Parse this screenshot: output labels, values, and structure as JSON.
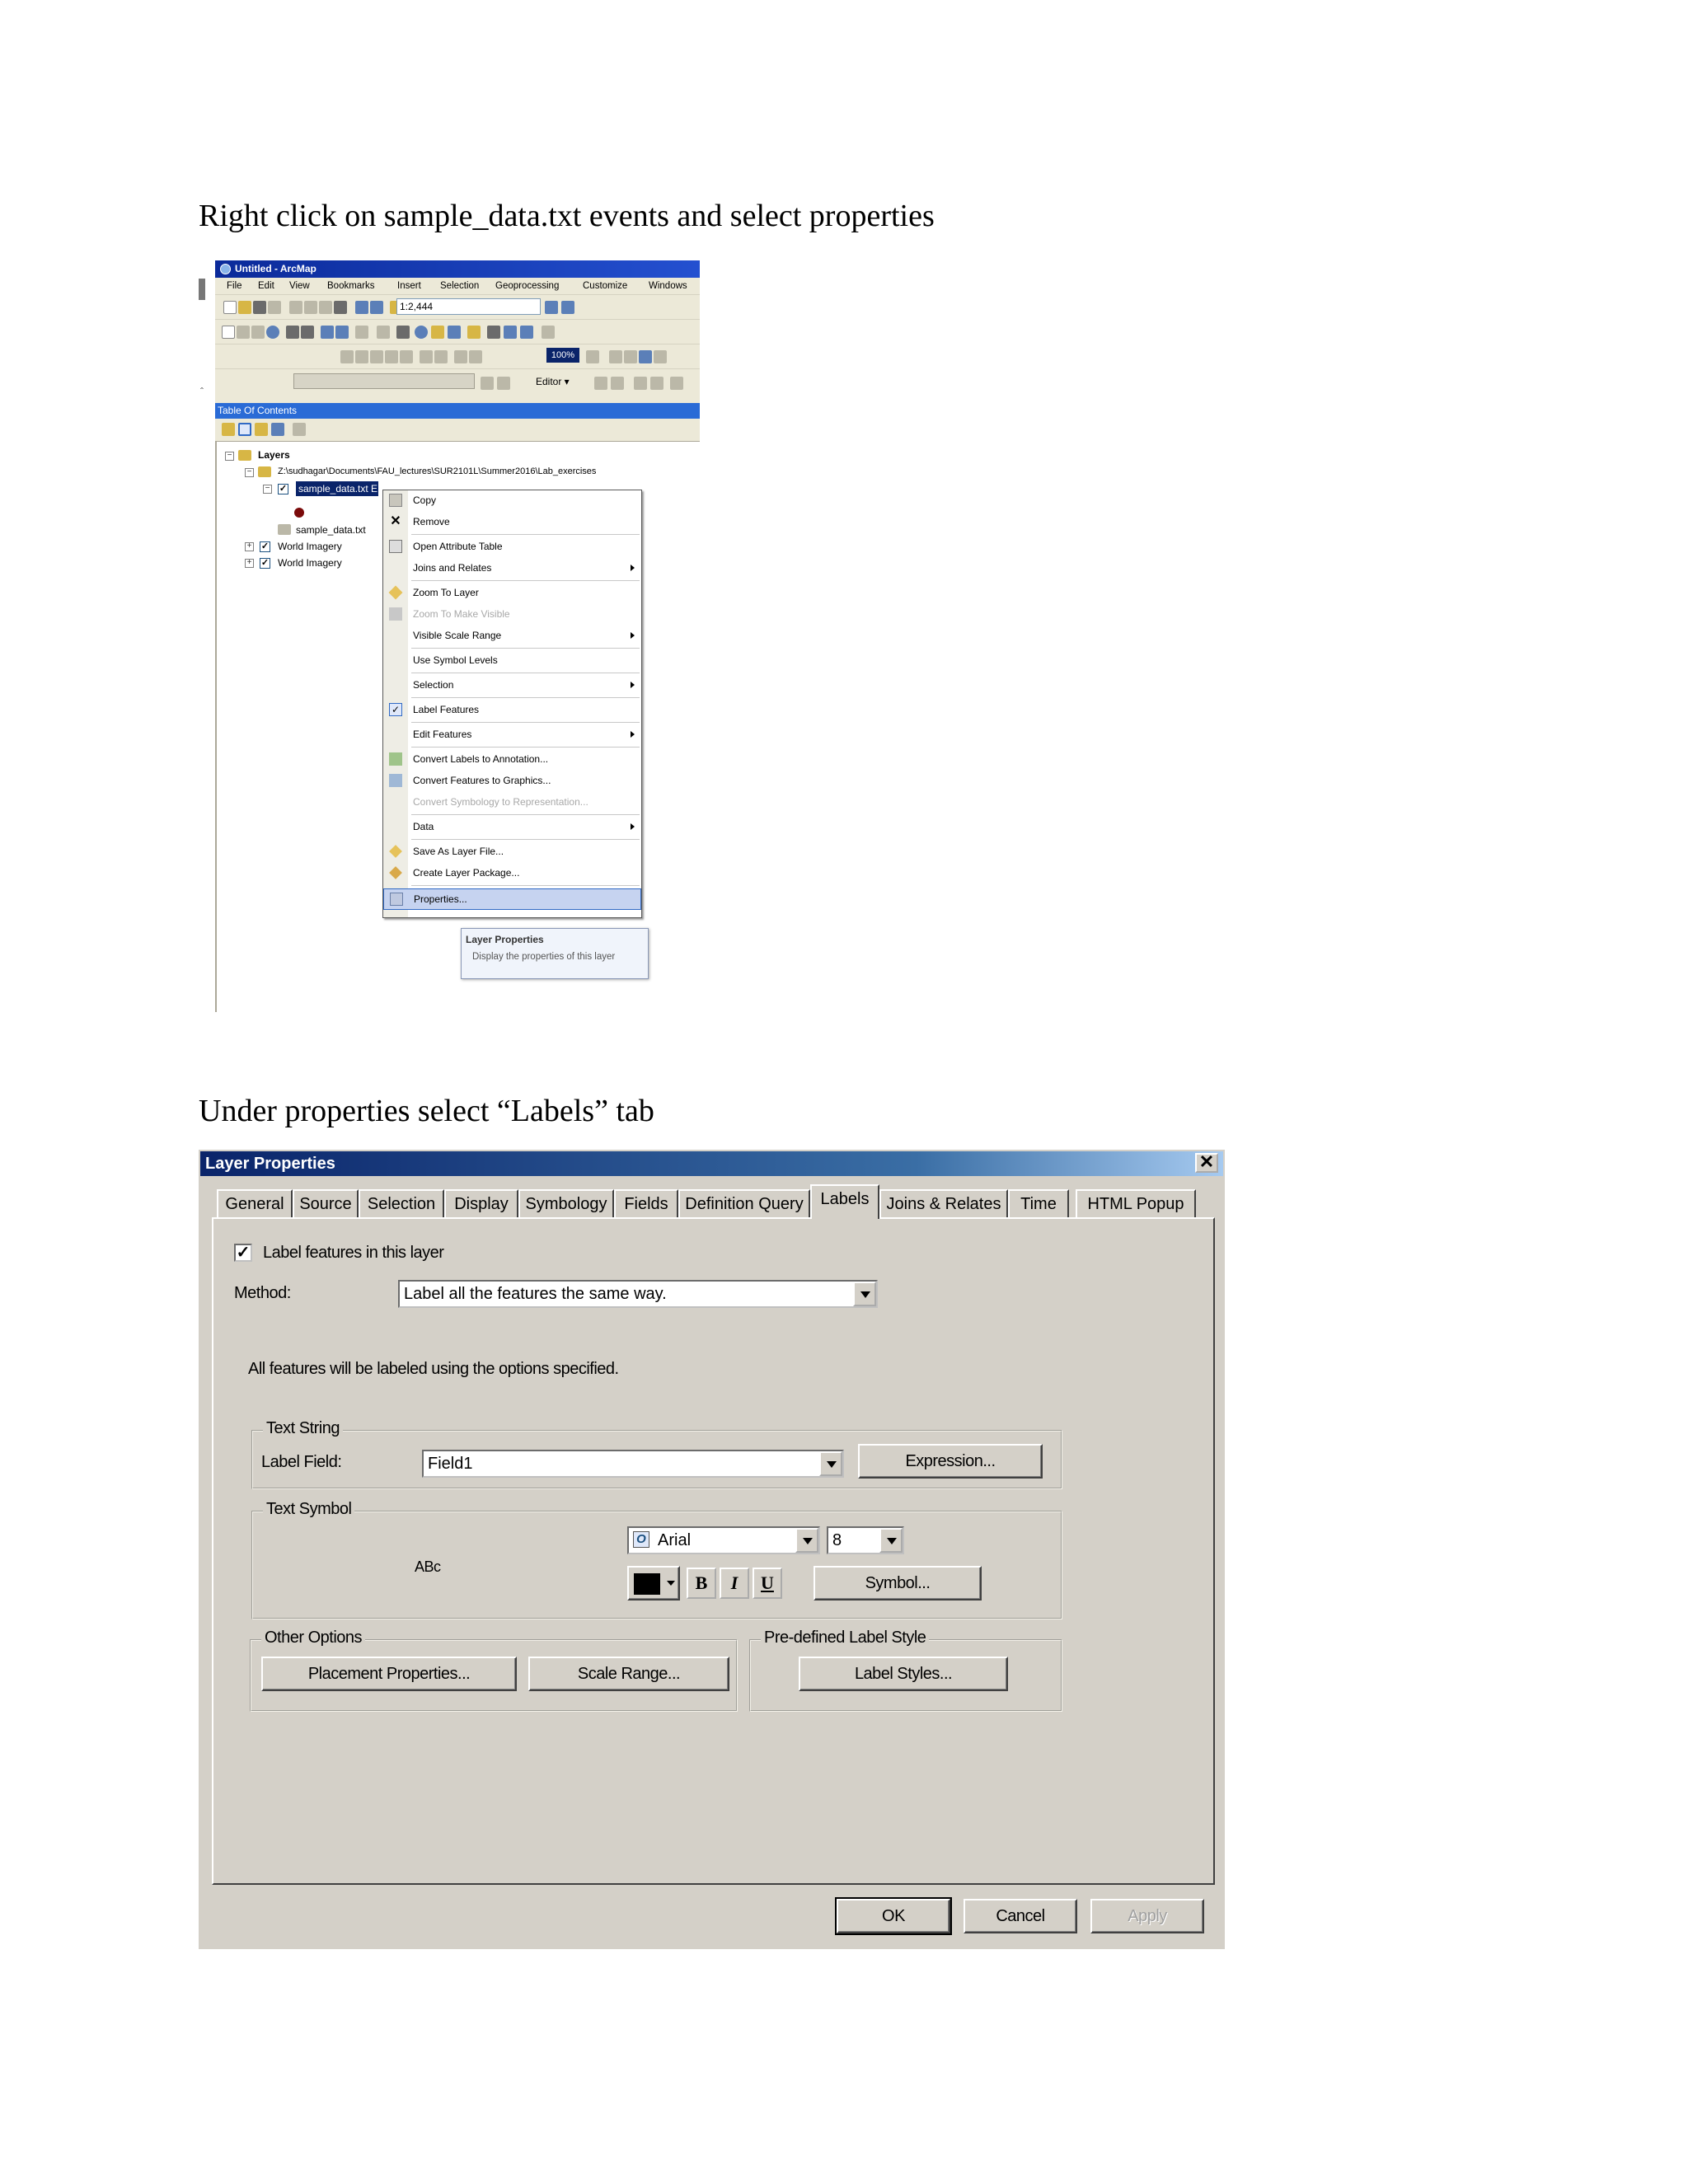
{
  "captions": {
    "step1": "Right click on sample_data.txt events and select properties",
    "step2": "Under properties select “Labels” tab"
  },
  "arcmap": {
    "window_title": "Untitled - ArcMap",
    "menu": [
      "File",
      "Edit",
      "View",
      "Bookmarks",
      "Insert",
      "Selection",
      "Geoprocessing",
      "Customize",
      "Windows"
    ],
    "scale_value": "1:2,444",
    "zoom_value": "100%",
    "editor_label": "Editor ▾",
    "toc": {
      "title": "Table Of Contents",
      "layers_label": "Layers",
      "path": "Z:\\sudhagar\\Documents\\FAU_lectures\\SUR2101L\\Summer2016\\Lab_exercises",
      "selected_layer": "sample_data.txt E",
      "table_layer": "sample_data.txt",
      "imagery1": "World Imagery",
      "imagery2": "World Imagery"
    },
    "context_menu": {
      "copy": "Copy",
      "remove": "Remove",
      "open_attribute_table": "Open Attribute Table",
      "joins_relates": "Joins and Relates",
      "zoom_to_layer": "Zoom To Layer",
      "zoom_make_visible": "Zoom To Make Visible",
      "visible_scale_range": "Visible Scale Range",
      "use_symbol_levels": "Use Symbol Levels",
      "selection": "Selection",
      "label_features": "Label Features",
      "edit_features": "Edit Features",
      "convert_labels": "Convert Labels to Annotation...",
      "convert_features": "Convert Features to Graphics...",
      "convert_symbology": "Convert Symbology to Representation...",
      "data": "Data",
      "save_layer_file": "Save As Layer File...",
      "create_layer_package": "Create Layer Package...",
      "properties": "Properties..."
    },
    "tooltip": {
      "title": "Layer Properties",
      "text": "Display the properties of this layer"
    }
  },
  "dialog": {
    "title": "Layer Properties",
    "close_glyph": "✕",
    "tabs": [
      "General",
      "Source",
      "Selection",
      "Display",
      "Symbology",
      "Fields",
      "Definition Query",
      "Labels",
      "Joins & Relates",
      "Time",
      "HTML Popup"
    ],
    "active_tab": "Labels",
    "label_features_checkbox": "Label features in this layer",
    "checkbox_mark": "✓",
    "method_label": "Method:",
    "method_value": "Label all the features the same way.",
    "info_text": "All features will be labeled using the options specified.",
    "text_string": {
      "group_title": "Text String",
      "label_field_label": "Label Field:",
      "label_field_value": "Field1",
      "expression_button": "Expression..."
    },
    "text_symbol": {
      "group_title": "Text Symbol",
      "preview": "ABc",
      "font_value": "Arial",
      "size_value": "8",
      "bold": "B",
      "italic": "I",
      "underline": "U",
      "symbol_button": "Symbol...",
      "font_color": "#000000"
    },
    "other_options": {
      "group_title": "Other Options",
      "placement_button": "Placement Properties...",
      "scale_range_button": "Scale Range..."
    },
    "predefined": {
      "group_title": "Pre-defined Label Style",
      "label_styles_button": "Label Styles..."
    },
    "footer": {
      "ok": "OK",
      "cancel": "Cancel",
      "apply": "Apply"
    }
  }
}
